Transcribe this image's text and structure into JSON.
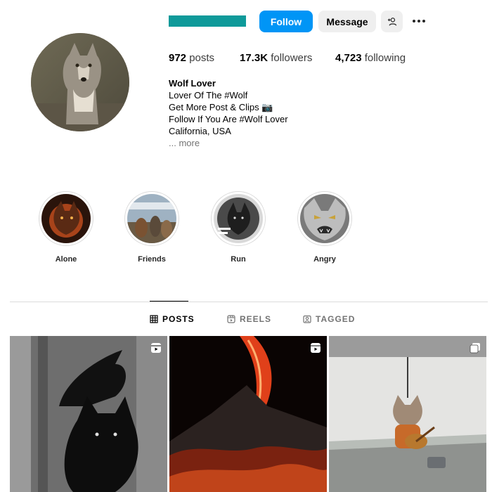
{
  "profile": {
    "follow_label": "Follow",
    "message_label": "Message",
    "stats": {
      "posts_count": "972",
      "posts_label": "posts",
      "followers_count": "17.3K",
      "followers_label": "followers",
      "following_count": "4,723",
      "following_label": "following"
    },
    "bio": {
      "name": "Wolf Lover",
      "lines": [
        "Lover Of The #Wolf",
        "Get More Post & Clips 📷",
        "Follow If You Are #Wolf Lover",
        "California, USA"
      ],
      "more": "... more"
    }
  },
  "highlights": [
    {
      "label": "Alone"
    },
    {
      "label": "Friends"
    },
    {
      "label": "Run"
    },
    {
      "label": "Angry"
    }
  ],
  "tabs": [
    {
      "label": "POSTS",
      "icon": "grid-icon",
      "active": true
    },
    {
      "label": "REELS",
      "icon": "reels-icon",
      "active": false
    },
    {
      "label": "TAGGED",
      "icon": "tagged-icon",
      "active": false
    }
  ],
  "posts": [
    {
      "badge": "reel-icon"
    },
    {
      "badge": "reel-icon"
    },
    {
      "badge": "carousel-icon"
    }
  ],
  "colors": {
    "accent": "#0095f6",
    "username_bar": "#0f9a9a"
  }
}
